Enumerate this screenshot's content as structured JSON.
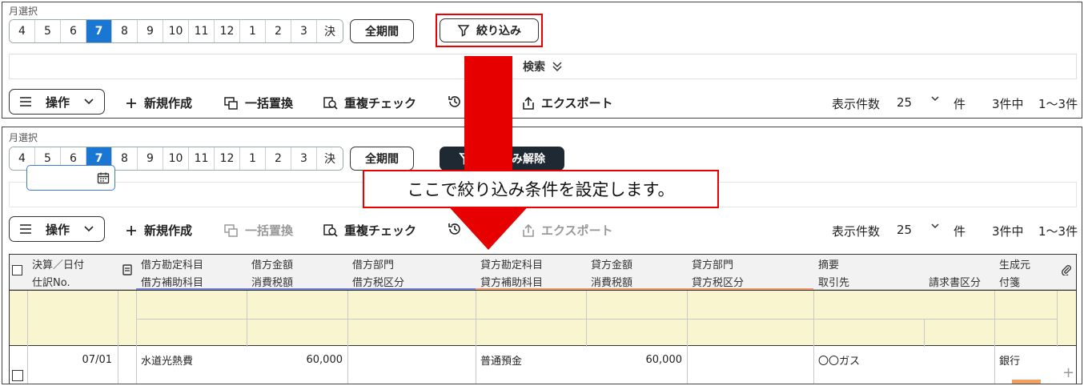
{
  "month_label": "月選択",
  "months": [
    "4",
    "5",
    "6",
    "7",
    "8",
    "9",
    "10",
    "11",
    "12",
    "1",
    "2",
    "3",
    "決"
  ],
  "selected_month": "7",
  "all_period_label": "全期間",
  "filter_label": "絞り込み",
  "filter_clear_label": "絞り込み解除",
  "search_label": "検索",
  "operations_label": "操作",
  "toolbar": {
    "new": "新規作成",
    "bulk_replace": "一括置換",
    "duplicate_check": "重複チェック",
    "history": "履歴",
    "export": "エクスポート"
  },
  "display_count_label": "表示件数",
  "display_count": "25",
  "count_unit": "件",
  "result_count": "3件中",
  "result_range": "1〜3件",
  "columns_row1": [
    "決算／日付",
    "借方勘定科目",
    "借方金額",
    "借方部門",
    "貸方勘定科目",
    "貸方金額",
    "貸方部門",
    "摘要",
    "生成元"
  ],
  "columns_row2": [
    "仕訳No.",
    "借方補助科目",
    "消費税額",
    "借方税区分",
    "貸方補助科目",
    "消費税額",
    "貸方税区分",
    "取引先",
    "請求書区分",
    "付箋"
  ],
  "callout_text": "ここで絞り込み条件を設定します。",
  "row1": {
    "date": "07/01",
    "debit_account": "水道光熱費",
    "debit_amount": "60,000",
    "credit_account": "普通預金",
    "credit_amount": "60,000",
    "summary": "〇〇ガス",
    "source": "銀行"
  },
  "colors": {
    "selected": "#1976d2",
    "highlight": "#e00000",
    "filter_fill": "#f8f5cf",
    "dark_button": "#1f2933"
  }
}
